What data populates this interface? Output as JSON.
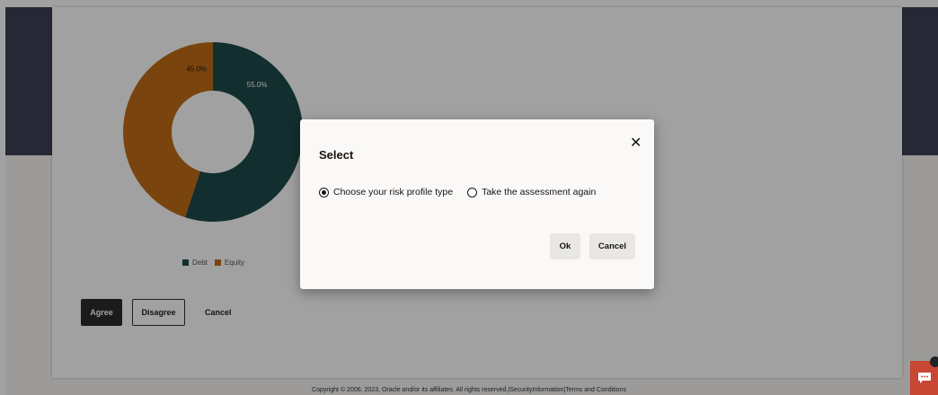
{
  "chart_data": {
    "type": "pie",
    "donut": true,
    "categories": [
      "Debt",
      "Equity"
    ],
    "values": [
      55.0,
      45.0
    ],
    "data_labels": [
      "55.0%",
      "45.0%"
    ],
    "colors": [
      "#1f4a4a",
      "#c26d17"
    ],
    "legend_position": "bottom"
  },
  "page": {
    "agree_label": "Agree",
    "disagree_label": "Disagree",
    "cancel_label": "Cancel",
    "copyright": "Copyright © 2006, 2023, Oracle and/or its affiliates. All rights reserved.|SecurityInformation|Terms and Conditions"
  },
  "modal": {
    "title": "Select",
    "close_icon": "close-icon",
    "options": [
      {
        "label": "Choose your risk profile type",
        "checked": true
      },
      {
        "label": "Take the assessment again",
        "checked": false
      }
    ],
    "ok_label": "Ok",
    "cancel_label": "Cancel"
  },
  "colors": {
    "brand_dark": "#3d4155",
    "accent_red": "#c74634"
  }
}
